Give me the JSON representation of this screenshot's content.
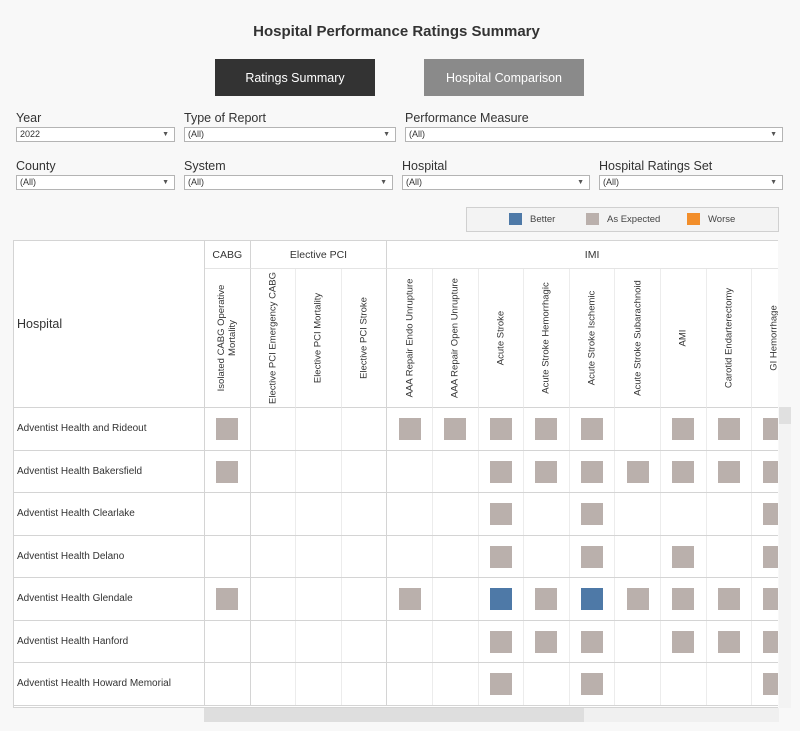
{
  "title": "Hospital Performance Ratings Summary",
  "tabs": [
    {
      "label": "Ratings Summary",
      "active": true
    },
    {
      "label": "Hospital Comparison",
      "active": false
    }
  ],
  "filters": {
    "year": {
      "label": "Year",
      "value": "2022"
    },
    "type_of_report": {
      "label": "Type of Report",
      "value": "(All)"
    },
    "performance_measure": {
      "label": "Performance Measure",
      "value": "(All)"
    },
    "county": {
      "label": "County",
      "value": "(All)"
    },
    "system": {
      "label": "System",
      "value": "(All)"
    },
    "hospital": {
      "label": "Hospital",
      "value": "(All)"
    },
    "hospital_ratings_set": {
      "label": "Hospital Ratings Set",
      "value": "(All)"
    }
  },
  "legend": [
    {
      "label": "Better",
      "color": "#4e79a7"
    },
    {
      "label": "As Expected",
      "color": "#bab0ac"
    },
    {
      "label": "Worse",
      "color": "#f28e2b"
    }
  ],
  "table": {
    "row_header": "Hospital",
    "groups": [
      {
        "label": "CABG",
        "span": 1
      },
      {
        "label": "Elective PCI",
        "span": 3
      },
      {
        "label": "IMI",
        "span": 9
      }
    ],
    "columns": [
      "Isolated CABG Operative Mortality",
      "Elective PCI Emergency CABG",
      "Elective PCI Mortality",
      "Elective PCI Stroke",
      "AAA Repair Endo Unrupture",
      "AAA Repair Open Unrupture",
      "Acute Stroke",
      "Acute Stroke Hemorrhagic",
      "Acute Stroke Ischemic",
      "Acute Stroke Subarachnoid",
      "AMI",
      "Carotid Endarterectomy",
      "GI Hemorrhage"
    ],
    "rows": [
      {
        "hospital": "Adventist Health and Rideout",
        "ratings": [
          "As Expected",
          "",
          "",
          "",
          "As Expected",
          "As Expected",
          "As Expected",
          "As Expected",
          "As Expected",
          "",
          "As Expected",
          "As Expected",
          "As Expected"
        ]
      },
      {
        "hospital": "Adventist Health Bakersfield",
        "ratings": [
          "As Expected",
          "",
          "",
          "",
          "",
          "",
          "As Expected",
          "As Expected",
          "As Expected",
          "As Expected",
          "As Expected",
          "As Expected",
          "As Expected"
        ]
      },
      {
        "hospital": "Adventist Health Clearlake",
        "ratings": [
          "",
          "",
          "",
          "",
          "",
          "",
          "As Expected",
          "",
          "As Expected",
          "",
          "",
          "",
          "As Expected"
        ]
      },
      {
        "hospital": "Adventist Health Delano",
        "ratings": [
          "",
          "",
          "",
          "",
          "",
          "",
          "As Expected",
          "",
          "As Expected",
          "",
          "As Expected",
          "",
          "As Expected"
        ]
      },
      {
        "hospital": "Adventist Health Glendale",
        "ratings": [
          "As Expected",
          "",
          "",
          "",
          "As Expected",
          "",
          "Better",
          "As Expected",
          "Better",
          "As Expected",
          "As Expected",
          "As Expected",
          "As Expected"
        ]
      },
      {
        "hospital": "Adventist Health Hanford",
        "ratings": [
          "",
          "",
          "",
          "",
          "",
          "",
          "As Expected",
          "As Expected",
          "As Expected",
          "",
          "As Expected",
          "As Expected",
          "As Expected"
        ]
      },
      {
        "hospital": "Adventist Health Howard Memorial",
        "ratings": [
          "",
          "",
          "",
          "",
          "",
          "",
          "As Expected",
          "",
          "As Expected",
          "",
          "",
          "",
          "As Expected"
        ]
      }
    ]
  }
}
